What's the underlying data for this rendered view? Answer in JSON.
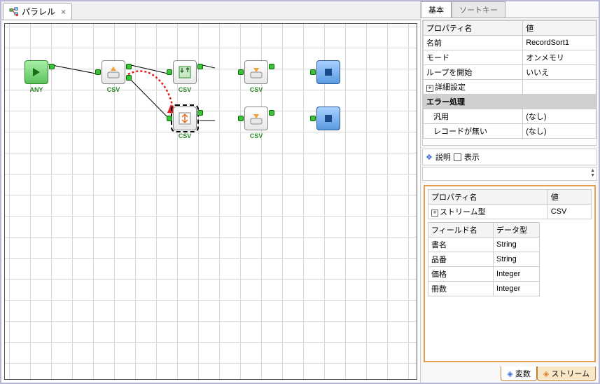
{
  "tab": {
    "title": "パラレル",
    "close": "×"
  },
  "nodes": {
    "start_label": "ANY",
    "csv_label": "CSV"
  },
  "props": {
    "tab_basic": "基本",
    "tab_sortkey": "ソートキー",
    "header_name": "プロパティ名",
    "header_value": "値",
    "rows": [
      {
        "name": "名前",
        "value": "RecordSort1"
      },
      {
        "name": "モード",
        "value": "オンメモリ"
      },
      {
        "name": "ループを開始",
        "value": "いいえ"
      },
      {
        "name": "詳細設定",
        "value": "",
        "expand": true
      },
      {
        "name": "エラー処理",
        "value": "",
        "selected": true
      },
      {
        "name": "汎用",
        "value": "(なし)",
        "indent": true
      },
      {
        "name": "レコードが無い",
        "value": "(なし)",
        "indent": true
      }
    ]
  },
  "desc": {
    "label": "説明",
    "show": "表示"
  },
  "stream": {
    "header_name": "プロパティ名",
    "header_value": "値",
    "type_label": "ストリーム型",
    "type_value": "CSV",
    "field_header_name": "フィールド名",
    "field_header_type": "データ型",
    "fields": [
      {
        "name": "書名",
        "type": "String"
      },
      {
        "name": "品番",
        "type": "String"
      },
      {
        "name": "価格",
        "type": "Integer"
      },
      {
        "name": "冊数",
        "type": "Integer"
      }
    ]
  },
  "bottom_tabs": {
    "var": "変数",
    "stream": "ストリーム"
  }
}
